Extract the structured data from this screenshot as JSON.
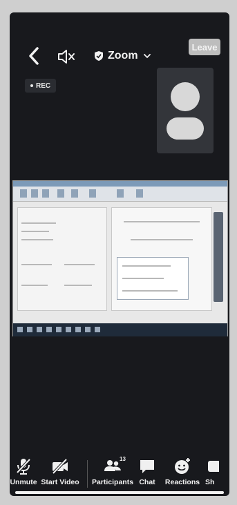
{
  "header": {
    "meeting_title": "Zoom",
    "leave_label": "Leave"
  },
  "recording": {
    "label": "REC"
  },
  "toolbar": {
    "unmute_label": "Unmute",
    "start_video_label": "Start Video",
    "participants_label": "Participants",
    "participants_count": "13",
    "chat_label": "Chat",
    "reactions_label": "Reactions",
    "share_label": "Sh"
  },
  "icons": {
    "back": "chevron-left-icon",
    "audio": "speaker-off-icon",
    "security": "shield-icon",
    "dropdown": "chevron-down-icon",
    "self_avatar": "user-avatar-icon",
    "mic": "mic-off-icon",
    "video": "video-off-icon",
    "participants": "people-icon",
    "chat": "chat-bubble-icon",
    "reactions": "smiley-plus-icon",
    "share": "share-screen-icon"
  },
  "colors": {
    "background": "#18191d",
    "text": "#f0f0f0",
    "leave_button": "#bdbdbd",
    "avatar": "#d8d8d8"
  }
}
